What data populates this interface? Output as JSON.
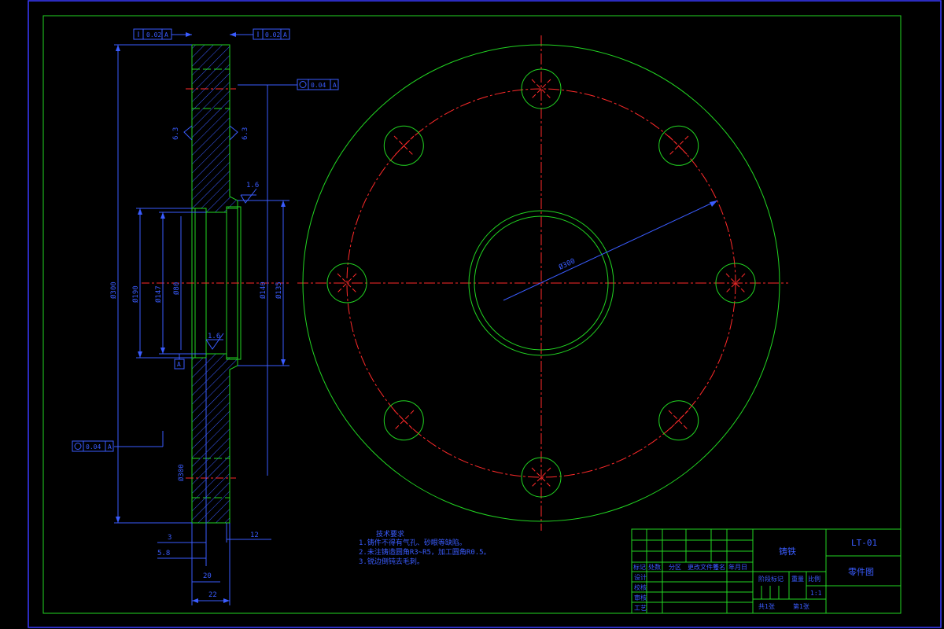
{
  "colors": {
    "frame_outer": "#3a3aff",
    "frame_inner": "#22d622",
    "geometry": "#22d622",
    "center_line": "#ff2a2a",
    "dimension": "#3a5cff",
    "hatch": "#3a5cff",
    "text": "#3a5cff",
    "background": "#000000"
  },
  "section_view": {
    "tolerance_top_left": "0.02",
    "tolerance_top_right": "0.02",
    "tolerance_mid_right": "0.04",
    "tolerance_left": "0.04",
    "roughness_1": "1.6",
    "roughness_2": "1.6",
    "roughness_3": "6.3",
    "roughness_4": "6.3",
    "datum_label": "A",
    "dims_vertical": [
      "Ø300",
      "Ø190",
      "Ø147",
      "Ø80",
      "Ø140",
      "Ø135"
    ],
    "dims_bottom": [
      "3",
      "5.8",
      "20",
      "12",
      "22"
    ]
  },
  "front_view": {
    "pcd_label": "Ø300"
  },
  "notes": {
    "title": "技术要求",
    "lines": [
      "1.铸件不得有气孔、砂眼等缺陷。",
      "2.未注铸造圆角R3~R5，加工圆角R0.5。",
      "3.锐边倒钝去毛刺。"
    ]
  },
  "title_block": {
    "material": "铸铁",
    "drawing_no": "LT-01",
    "drawing_name": "零件图",
    "scale": "1:1",
    "labels": [
      "标记",
      "处数",
      "分区",
      "更改文件号",
      "签名",
      "年月日"
    ],
    "roles": [
      "设计",
      "校核",
      "审核",
      "工艺"
    ],
    "stage_label": "阶段标记",
    "weight_label": "重量",
    "scale_label": "比例",
    "sheet_label": "共1张",
    "sheet_no": "第1张"
  }
}
